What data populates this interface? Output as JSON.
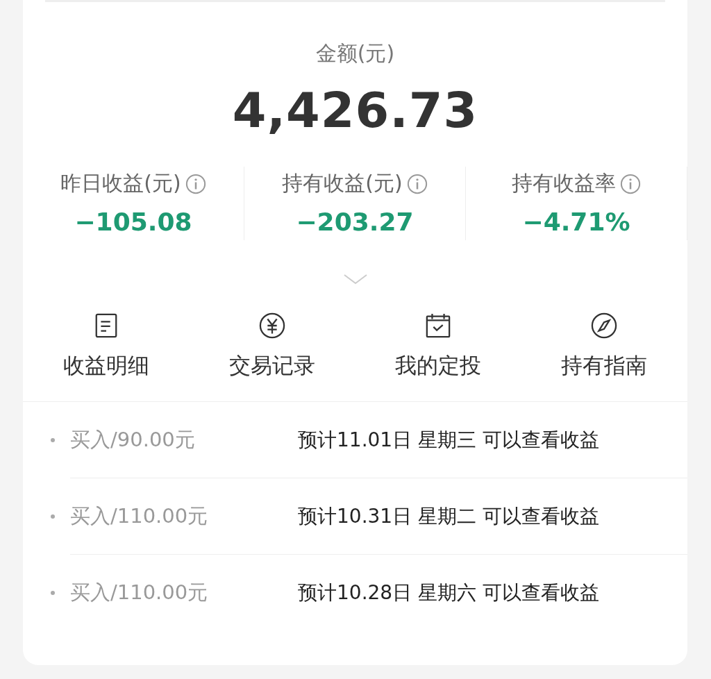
{
  "balance": {
    "label": "金额(元)",
    "amount": "4,426.73"
  },
  "stats": [
    {
      "label": "昨日收益(元)",
      "value": "−105.08"
    },
    {
      "label": "持有收益(元)",
      "value": "−203.27"
    },
    {
      "label": "持有收益率",
      "value": "−4.71%"
    }
  ],
  "actions": [
    {
      "kind": "document",
      "label": "收益明细"
    },
    {
      "kind": "yen",
      "label": "交易记录"
    },
    {
      "kind": "calendar",
      "label": "我的定投"
    },
    {
      "kind": "compass",
      "label": "持有指南"
    }
  ],
  "pending": [
    {
      "order": "买入/90.00元",
      "note": "预计11.01日 星期三 可以查看收益"
    },
    {
      "order": "买入/110.00元",
      "note": "预计10.31日 星期二 可以查看收益"
    },
    {
      "order": "买入/110.00元",
      "note": "预计10.28日 星期六 可以查看收益"
    }
  ]
}
